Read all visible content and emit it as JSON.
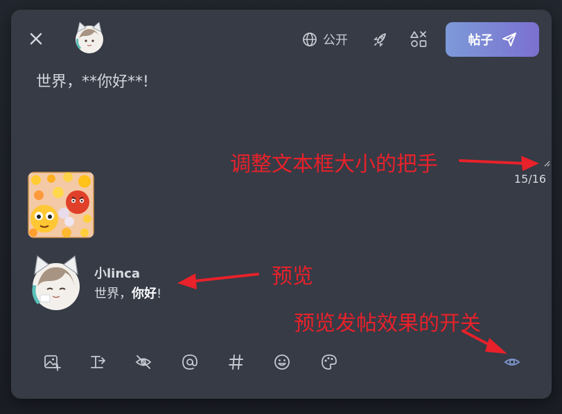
{
  "header": {
    "visibility_label": "公开",
    "post_button_label": "帖子"
  },
  "composer": {
    "text": "世界，**你好**!",
    "counter": "15/16"
  },
  "preview": {
    "username": "小linca",
    "text_plain": "世界，",
    "text_bold": "你好",
    "text_end": "!"
  },
  "annotations": {
    "resize_handle": "调整文本框大小的把手",
    "preview": "预览",
    "preview_toggle": "预览发帖效果的开关"
  },
  "toolbar": {
    "items": [
      {
        "icon": "add-image-icon"
      },
      {
        "icon": "text-format-icon"
      },
      {
        "icon": "hide-eye-icon"
      },
      {
        "icon": "mention-icon"
      },
      {
        "icon": "hashtag-icon"
      },
      {
        "icon": "emoji-icon"
      },
      {
        "icon": "palette-icon"
      },
      {
        "icon": "preview-eye-icon"
      }
    ]
  },
  "colors": {
    "dialog_bg": "#363b46",
    "accent_start": "#7c9ad8",
    "accent_end": "#7b70d0",
    "icon": "#c7cbd3",
    "active_icon": "#7d93c9",
    "annotation": "#e8212a"
  }
}
